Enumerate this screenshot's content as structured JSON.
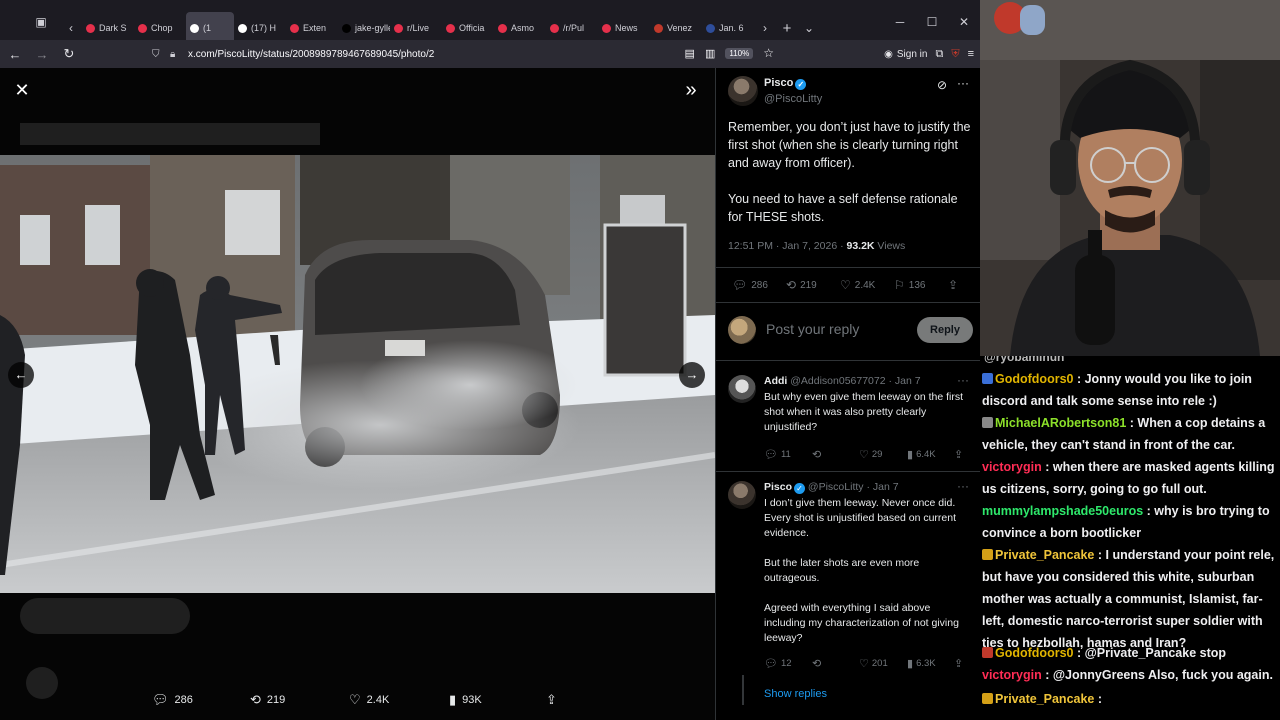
{
  "browser": {
    "tabs": [
      {
        "label": "Dark S",
        "color": "#e5304b",
        "active": false
      },
      {
        "label": "Chop",
        "color": "#e5304b",
        "active": false
      },
      {
        "label": "(1",
        "color": "#ffffff",
        "active": true
      },
      {
        "label": "(17) H",
        "color": "#ffffff",
        "active": false
      },
      {
        "label": "Exten",
        "color": "#e5304b",
        "active": false
      },
      {
        "label": "jake-gylle",
        "color": "#000000",
        "active": false
      },
      {
        "label": "r/Live",
        "color": "#e5304b",
        "active": false
      },
      {
        "label": "Officia",
        "color": "#e5304b",
        "active": false
      },
      {
        "label": "Asmo",
        "color": "#e5304b",
        "active": false
      },
      {
        "label": "/r/Pul",
        "color": "#e5304b",
        "active": false
      },
      {
        "label": "News",
        "color": "#e5304b",
        "active": false
      },
      {
        "label": "Venez",
        "color": "#c0392b",
        "active": false
      },
      {
        "label": "Jan. 6",
        "color": "#2e4d9a",
        "active": false
      }
    ],
    "url": "x.com/PiscoLitty/status/2008989789467689045/photo/2",
    "zoom": "110%",
    "signin": "Sign in"
  },
  "viewer": {
    "action_bar": {
      "replies": "286",
      "reposts": "219",
      "likes": "2.4K",
      "views": "93K"
    }
  },
  "tweet": {
    "name": "Pisco",
    "handle": "@PiscoLitty",
    "text": "Remember, you don’t just have to justify the first shot (when she is clearly turning right and away from officer).\n\nYou need to have a self defense rationale for THESE shots.",
    "time": "12:51 PM · Jan 7, 2026 · ",
    "views_count": "93.2K",
    "views_label": " Views",
    "stats": {
      "replies": "286",
      "reposts": "219",
      "likes": "2.4K",
      "bookmarks": "136"
    },
    "reply_placeholder": "Post your reply",
    "reply_button": "Reply"
  },
  "replies": [
    {
      "name": "Addi",
      "handle": " @Addison05677072 · Jan 7",
      "text": "But why even give them leeway on the first shot when it was also pretty clearly unjustified?",
      "stats": {
        "replies": "11",
        "likes": "29",
        "views": "6.4K"
      }
    },
    {
      "name": "Pisco",
      "handle": " @PiscoLitty · Jan 7",
      "text": "I don’t give them leeway. Never once did. Every shot is unjustified based on current evidence.\n\nBut the later shots are even more outrageous.\n\nAgreed with everything I said above including my characterization of not giving leeway?",
      "stats": {
        "replies": "12",
        "likes": "201",
        "views": "6.3K"
      }
    }
  ],
  "show_replies": "Show replies",
  "chat": {
    "top_fragment": "@ryobaminun",
    "messages": [
      {
        "user": "Godofdoors0",
        "color": "#e1b500",
        "text": "Jonny would you like to join discord and talk some sense into rele :)",
        "badge": "#3a6fd8"
      },
      {
        "user": "MichaelARobertson81",
        "color": "#8ce02a",
        "text": "When a cop detains a vehicle, they can't stand in front of the car.",
        "badge": "#888888"
      },
      {
        "user": "victorygin",
        "color": "#ff2d55",
        "text": "when there are masked agents killing us citizens, sorry, going to go full out.",
        "badge": ""
      },
      {
        "user": "mummylampshade50euros",
        "color": "#2ee86b",
        "text": "why is bro trying to convince a born bootlicker",
        "badge": ""
      },
      {
        "user": "Private_Pancake",
        "color": "#f0c53a",
        "text": "I understand your point rele, but have you considered this white, suburban mother was actually a communist, Islamist, far-left, domestic narco-terrorist super soldier with ties to hezbollah, hamas and Iran?",
        "badge": "#d4a017"
      },
      {
        "user": "Godofdoors0",
        "color": "#e1b500",
        "text": "@Private_Pancake stop",
        "badge": "#c0392b"
      },
      {
        "user": "victorygin",
        "color": "#ff2d55",
        "text": "@JonnyGreens Also, fuck you again.",
        "badge": ""
      },
      {
        "user": "Private_Pancake",
        "color": "#f0c53a",
        "text": "",
        "badge": "#d4a017"
      }
    ]
  },
  "colors": {
    "accent": "#1d9bf0",
    "muted": "#71767b"
  }
}
